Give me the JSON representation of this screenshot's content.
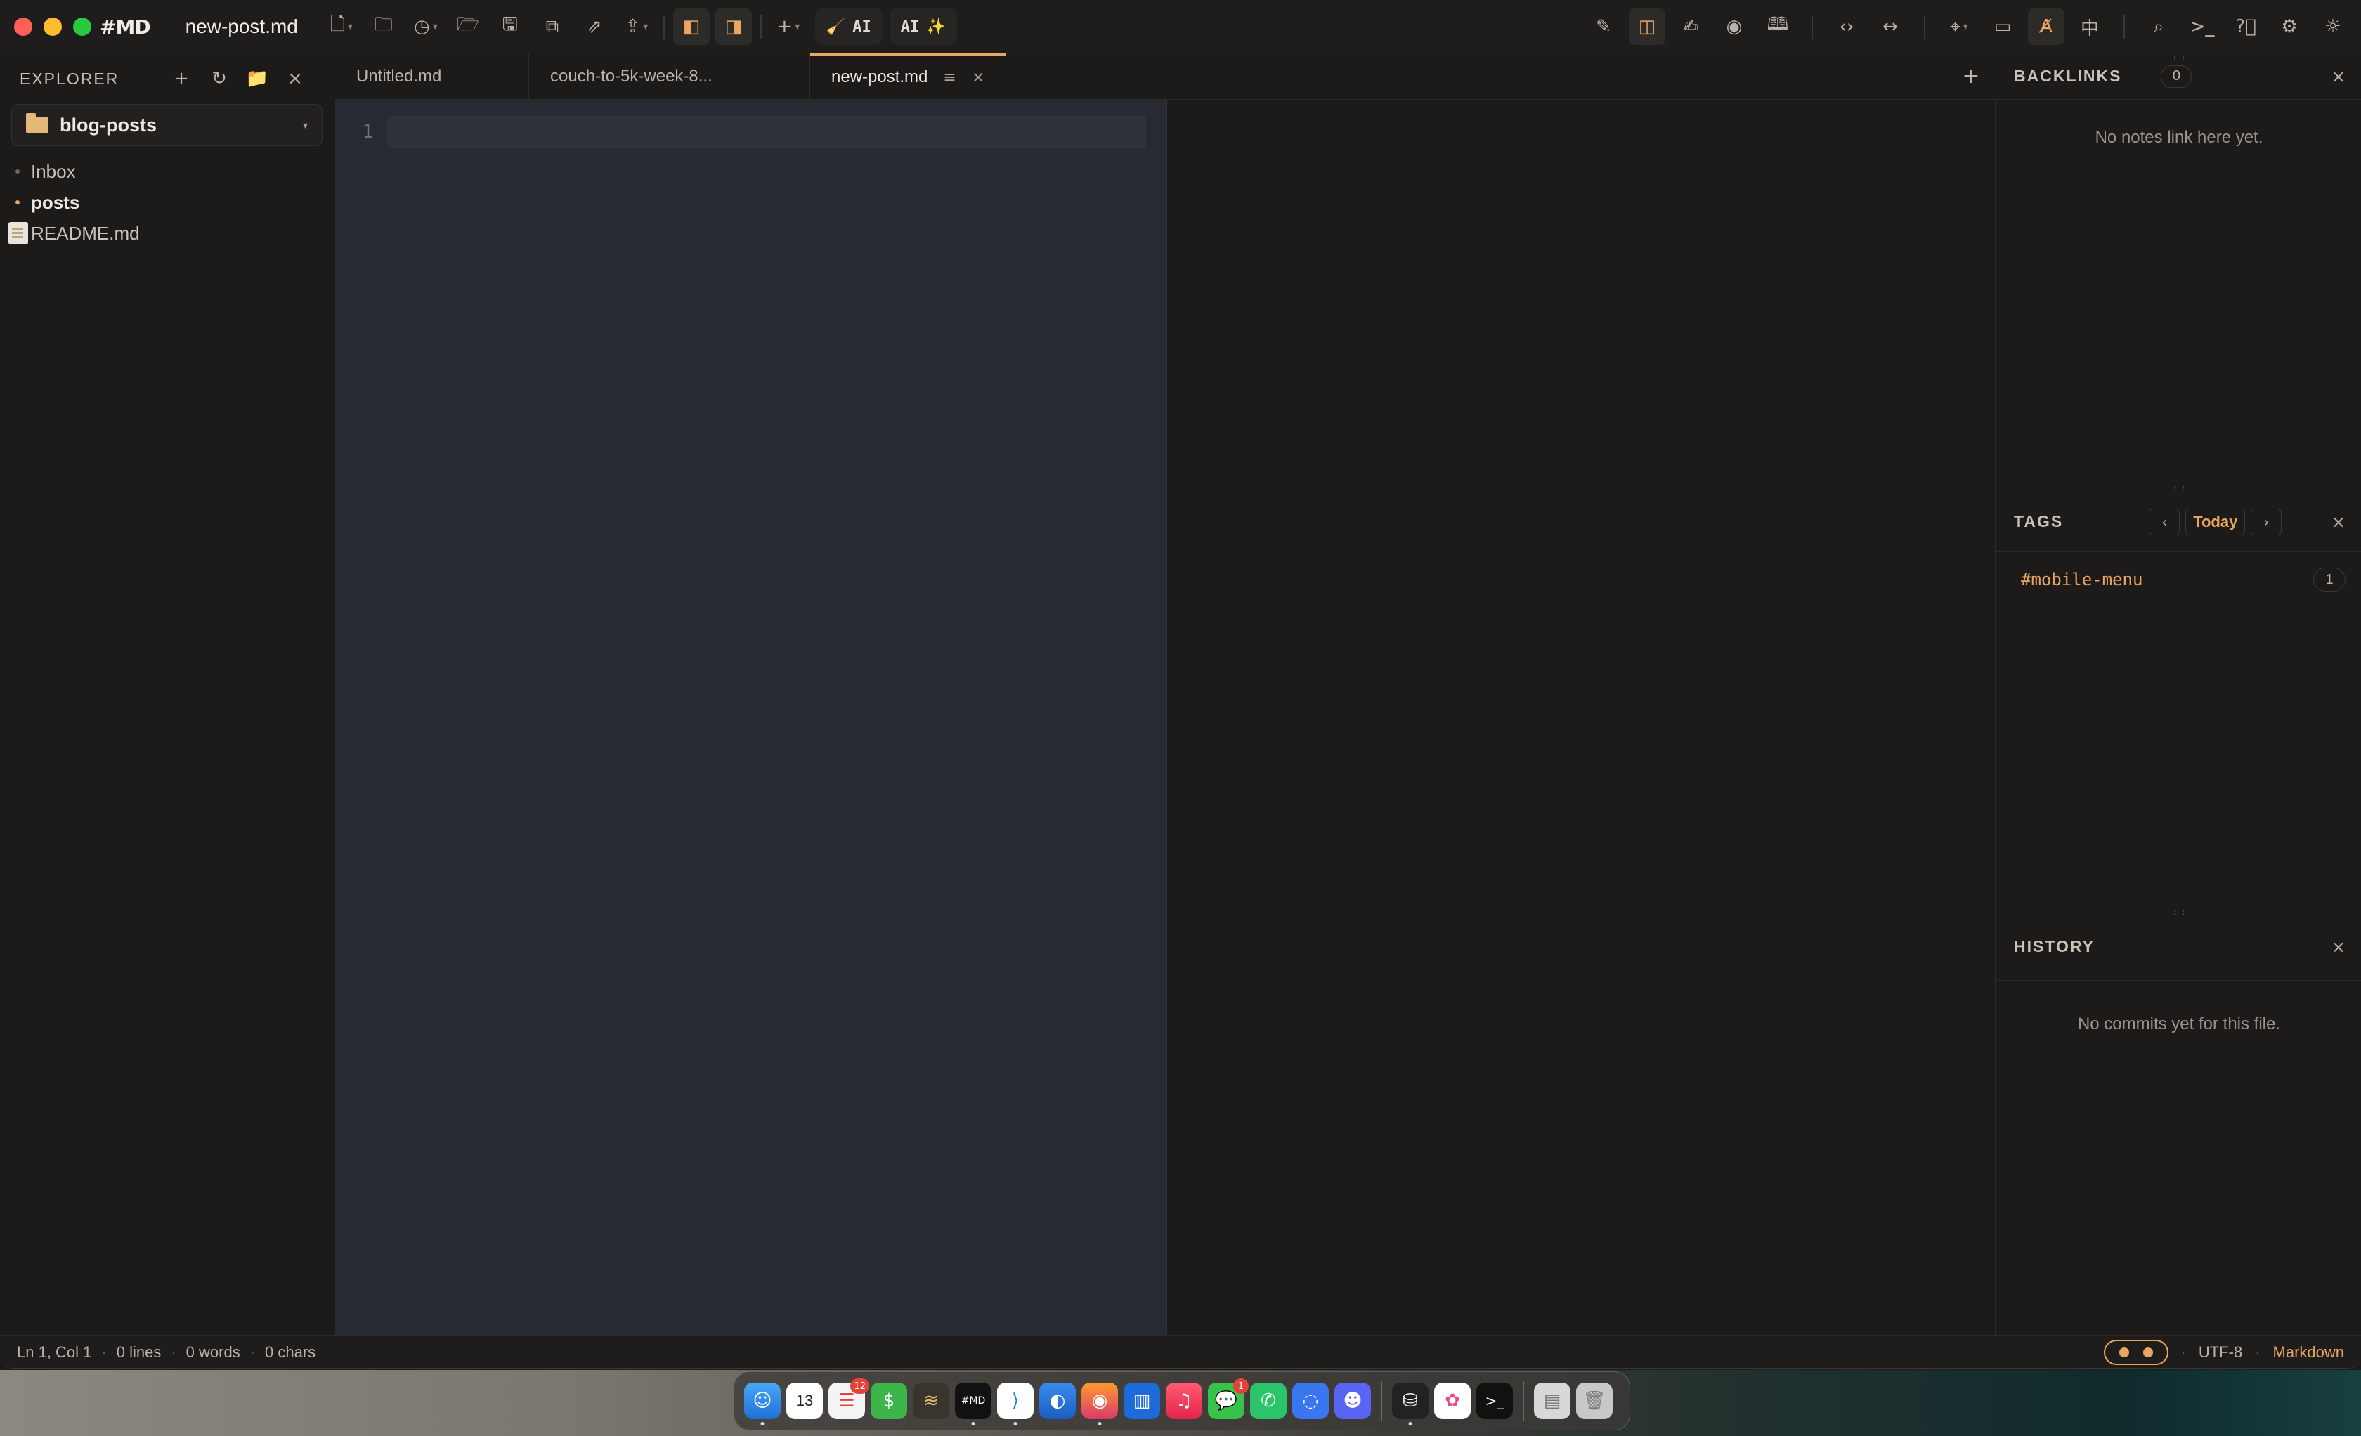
{
  "app": {
    "logo": "#MD",
    "window_title": "new-post.md"
  },
  "toolbar": {
    "left_icons": [
      "new-file-icon",
      "recent-icon",
      "open-folder-icon",
      "folder-icon",
      "save-icon",
      "save-all-icon",
      "open-external-icon",
      "export-icon"
    ],
    "layout_icons": [
      "split-left-icon",
      "split-right-icon"
    ],
    "ai_button_1": "AI",
    "ai_button_2": "AI",
    "right_icons": [
      "edit-icon",
      "split-view-icon",
      "notes-icon",
      "preview-icon",
      "book-icon",
      "code-icon",
      "width-icon",
      "focus-icon",
      "present-icon",
      "spellcheck-icon",
      "chinese-icon",
      "search-icon",
      "terminal-icon",
      "help-icon",
      "settings-icon",
      "theme-icon"
    ],
    "cjk_label": "中"
  },
  "sidebar": {
    "title": "EXPLORER",
    "workspace": "blog-posts",
    "items": [
      {
        "label": "Inbox",
        "type": "folder"
      },
      {
        "label": "posts",
        "type": "folder"
      },
      {
        "label": "README.md",
        "type": "file"
      }
    ]
  },
  "tabs": [
    {
      "label": "Untitled.md",
      "active": false
    },
    {
      "label": "couch-to-5k-week-8...",
      "active": false
    },
    {
      "label": "new-post.md",
      "active": true
    }
  ],
  "editor": {
    "line_numbers": [
      "1"
    ]
  },
  "backlinks": {
    "title": "BACKLINKS",
    "count": "0",
    "empty": "No notes link here yet."
  },
  "tags": {
    "title": "TAGS",
    "today": "Today",
    "items": [
      {
        "name": "#mobile-menu",
        "count": "1"
      }
    ]
  },
  "history": {
    "title": "HISTORY",
    "empty": "No commits yet for this file."
  },
  "status": {
    "position": "Ln 1, Col 1",
    "lines": "0 lines",
    "words": "0 words",
    "chars": "0 chars",
    "encoding": "UTF-8",
    "language": "Markdown"
  },
  "dock": {
    "calendar_day": "13",
    "badges": {
      "reminders": "12",
      "messages": "1"
    }
  },
  "colors": {
    "accent": "#e8a661",
    "editor_bg": "#272a32",
    "app_bg": "#1c1b19"
  }
}
